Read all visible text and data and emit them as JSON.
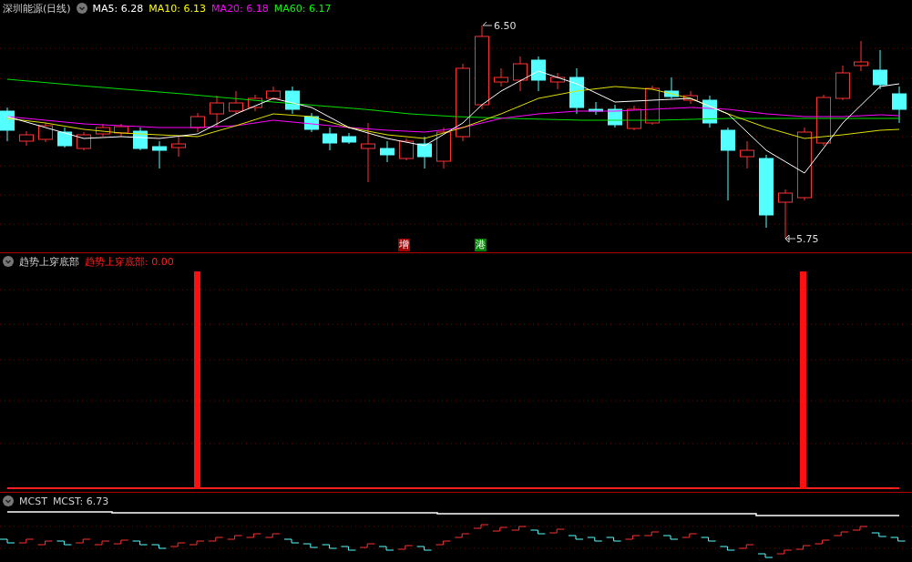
{
  "main_panel": {
    "title": "深圳能源(日线)",
    "indicators": [
      {
        "label": "MA5: 6.28",
        "color": "#ffffff"
      },
      {
        "label": "MA10: 6.13",
        "color": "#ffff00"
      },
      {
        "label": "MA20: 6.18",
        "color": "#ff00ff"
      },
      {
        "label": "MA60: 6.17",
        "color": "#00ff00"
      }
    ],
    "high_label": "6.50",
    "low_label": "5.75",
    "markers": [
      {
        "text": "增",
        "color": "#a00000"
      },
      {
        "text": "港",
        "color": "#008000"
      }
    ]
  },
  "indicator_panel": {
    "name": "趋势上穿底部",
    "reading": "趋势上穿底部: 0.00"
  },
  "mcst_panel": {
    "name": "MCST",
    "reading": "MCST: 6.73"
  }
}
